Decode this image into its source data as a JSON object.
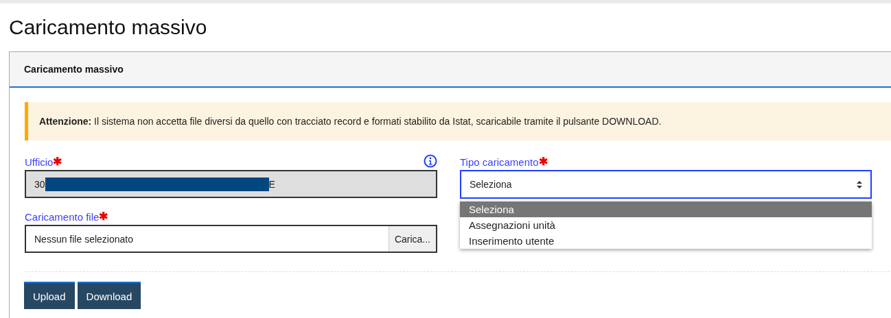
{
  "page_title": "Caricamento massivo",
  "panel": {
    "title": "Caricamento massivo",
    "alert": {
      "text": "**Attenzione:** Il sistema non accetta file diversi da quello con tracciato record e formati stabilito da Istat, scaricabile tramite il pulsante DOWNLOAD."
    },
    "ufficio": {
      "label": "Ufficio",
      "required_mark": "✱",
      "value_parts": [
        "30",
        "E"
      ],
      "disabled": true
    },
    "file": {
      "label": "Caricamento file",
      "required_mark": "✱",
      "value": "Nessun file selezionato",
      "button": "Carica..."
    },
    "tipo": {
      "label": "Tipo caricamento",
      "required_mark": "✱",
      "value": "Seleziona",
      "expanded": true,
      "options": [
        {
          "label": "Seleziona",
          "selected": true
        },
        {
          "label": "Assegnazioni unità",
          "selected": false
        },
        {
          "label": "Inserimento utente",
          "selected": false
        }
      ]
    },
    "buttons": [
      "Upload",
      "Download"
    ]
  }
}
